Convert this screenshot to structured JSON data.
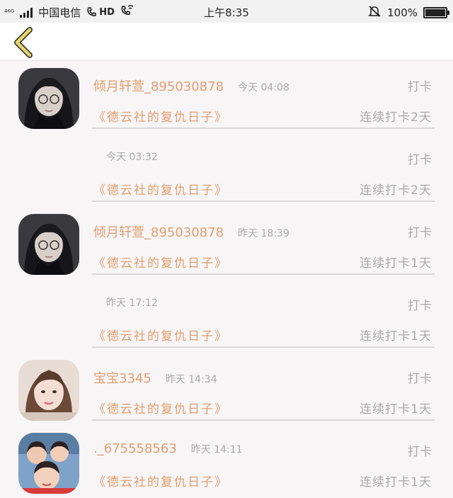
{
  "status_bar": {
    "network": "⁴⁶ᴳ",
    "carrier": "中国电信",
    "hd": "HD",
    "time": "上午8:35",
    "battery": "100%",
    "battery_level": 1.0
  },
  "entries": [
    {
      "name": "倾月轩萱_895030878",
      "time": "今天 04:08",
      "checkin": "打卡",
      "book": "《德云社的复仇日子》",
      "streak": "连续打卡2天",
      "avatar": "girl-glasses"
    },
    {
      "name": "",
      "time": "今天 03:32",
      "checkin": "打卡",
      "book": "《德云社的复仇日子》",
      "streak": "连续打卡2天",
      "avatar": ""
    },
    {
      "name": "倾月轩萱_895030878",
      "time": "昨天 18:39",
      "checkin": "打卡",
      "book": "《德云社的复仇日子》",
      "streak": "连续打卡1天",
      "avatar": "girl-glasses"
    },
    {
      "name": "",
      "time": "昨天 17:12",
      "checkin": "打卡",
      "book": "《德云社的复仇日子》",
      "streak": "连续打卡1天",
      "avatar": ""
    },
    {
      "name": "宝宝3345",
      "time": "昨天 14:34",
      "checkin": "打卡",
      "book": "《德云社的复仇日子》",
      "streak": "连续打卡1天",
      "avatar": "girl-photo"
    },
    {
      "name": "._675558563",
      "time": "昨天 14:11",
      "checkin": "打卡",
      "book": "《德云社的复仇日子》",
      "streak": "连续打卡1天",
      "avatar": "kids-photo"
    }
  ],
  "colors": {
    "accent": "#e29e6f",
    "muted": "#aaaaaa",
    "back_arrow": "#e8d86a"
  }
}
